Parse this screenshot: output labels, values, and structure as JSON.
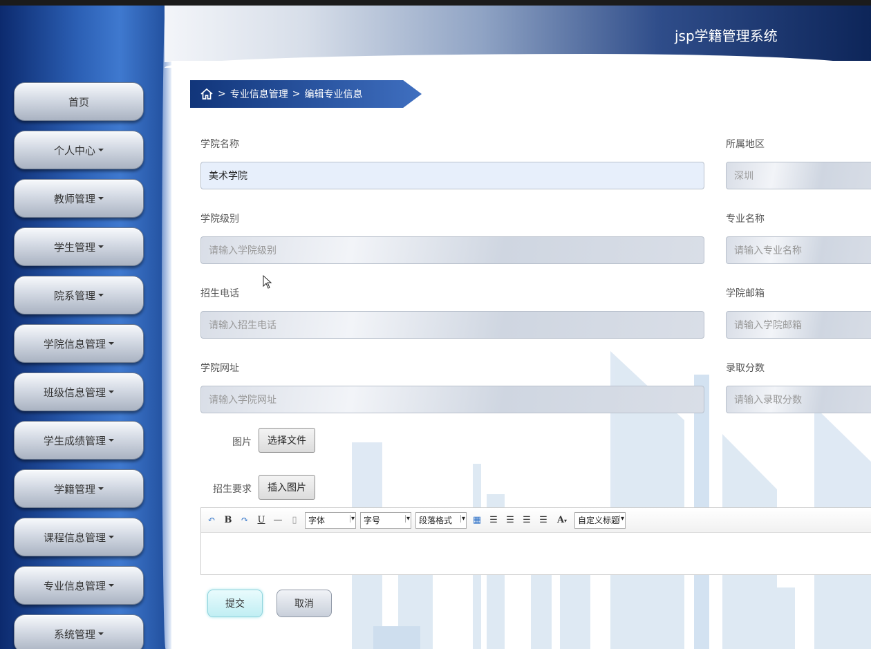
{
  "app": {
    "title": "jsp学籍管理系统"
  },
  "sidebar": {
    "items": [
      {
        "label": "首页",
        "has_dropdown": false
      },
      {
        "label": "个人中心",
        "has_dropdown": true
      },
      {
        "label": "教师管理",
        "has_dropdown": true
      },
      {
        "label": "学生管理",
        "has_dropdown": true
      },
      {
        "label": "院系管理",
        "has_dropdown": true
      },
      {
        "label": "学院信息管理",
        "has_dropdown": true
      },
      {
        "label": "班级信息管理",
        "has_dropdown": true
      },
      {
        "label": "学生成绩管理",
        "has_dropdown": true
      },
      {
        "label": "学籍管理",
        "has_dropdown": true
      },
      {
        "label": "课程信息管理",
        "has_dropdown": true
      },
      {
        "label": "专业信息管理",
        "has_dropdown": true
      },
      {
        "label": "系统管理",
        "has_dropdown": true
      }
    ]
  },
  "breadcrumb": {
    "separator": ">",
    "level1": "专业信息管理",
    "level2": "编辑专业信息"
  },
  "form": {
    "college_name": {
      "label": "学院名称",
      "value": "美术学院"
    },
    "region": {
      "label": "所属地区",
      "value": "深圳"
    },
    "college_level": {
      "label": "学院级别",
      "placeholder": "请输入学院级别"
    },
    "major_name": {
      "label": "专业名称",
      "placeholder": "请输入专业名称"
    },
    "phone": {
      "label": "招生电话",
      "placeholder": "请输入招生电话"
    },
    "email": {
      "label": "学院邮箱",
      "placeholder": "请输入学院邮箱"
    },
    "website": {
      "label": "学院网址",
      "placeholder": "请输入学院网址"
    },
    "score": {
      "label": "录取分数",
      "placeholder": "请输入录取分数"
    },
    "image": {
      "label": "图片",
      "button": "选择文件"
    },
    "requirements": {
      "label": "招生要求",
      "button": "插入图片"
    }
  },
  "editor": {
    "font_select": "字体",
    "size_select": "字号",
    "paragraph_select": "段落格式",
    "custom_title_select": "自定义标题",
    "bold": "B",
    "underline": "U",
    "font_color": "A"
  },
  "actions": {
    "submit": "提交",
    "cancel": "取消"
  }
}
